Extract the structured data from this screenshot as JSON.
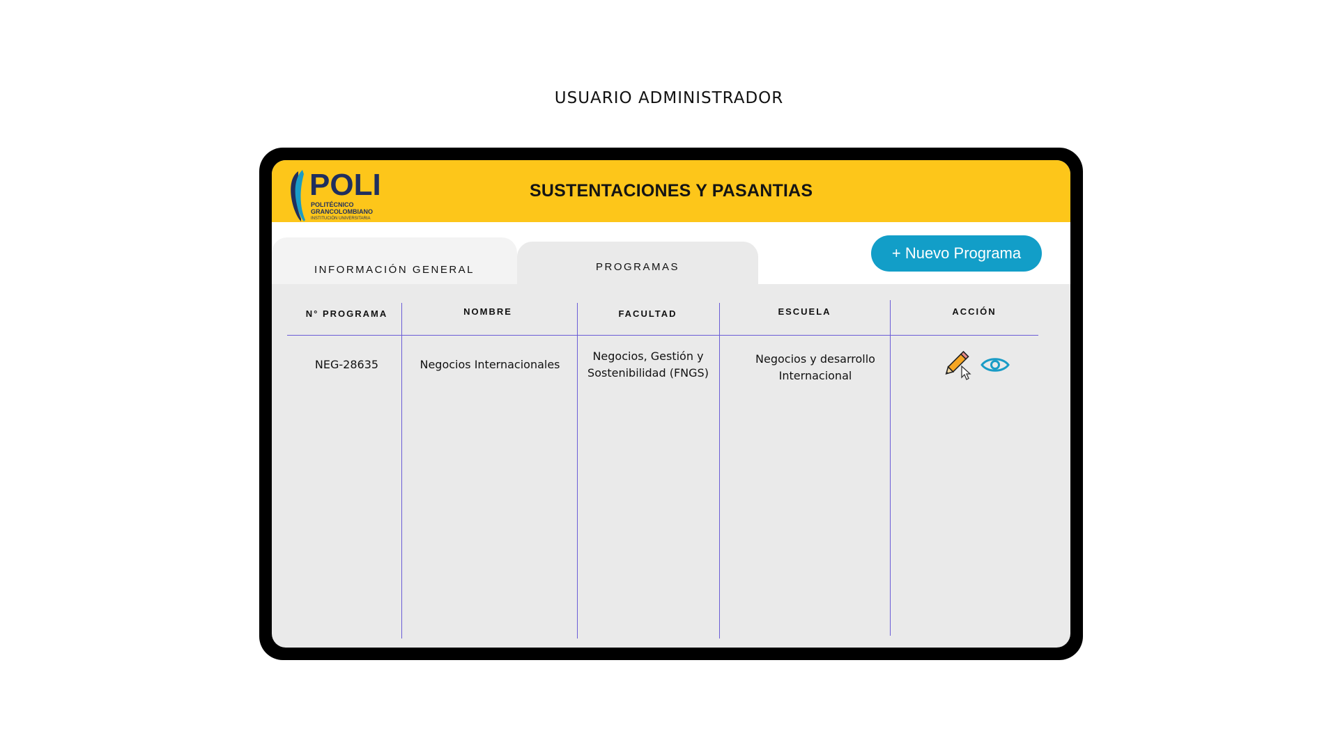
{
  "page_heading": "USUARIO ADMINISTRADOR",
  "header": {
    "logo_text": "POLI",
    "logo_line1": "POLITÉCNICO",
    "logo_line2": "GRANCOLOMBIANO",
    "logo_line3": "INSTITUCIÓN UNIVERSITARIA",
    "title": "SUSTENTACIONES Y PASANTIAS"
  },
  "tabs": [
    {
      "label": "INFORMACIÓN GENERAL"
    },
    {
      "label": "PROGRAMAS"
    }
  ],
  "new_program_button": "+ Nuevo Programa",
  "table": {
    "columns": [
      "N° PROGRAMA",
      "NOMBRE",
      "FACULTAD",
      "ESCUELA",
      "ACCIÓN"
    ],
    "rows": [
      {
        "numero": "NEG-28635",
        "nombre": "Negocios Internacionales",
        "facultad_line1": "Negocios, Gestión y",
        "facultad_line2": "Sostenibilidad (FNGS)",
        "escuela_line1": "Negocios y desarrollo",
        "escuela_line2": "Internacional",
        "actions": [
          "pencil-icon",
          "eye-icon"
        ]
      }
    ]
  },
  "colors": {
    "header_bg": "#fdc61a",
    "button_bg": "#129ec8",
    "grid_lines": "#6a5cd6",
    "logo_navy": "#1f2f5e",
    "eye_icon": "#1a9cc6"
  }
}
